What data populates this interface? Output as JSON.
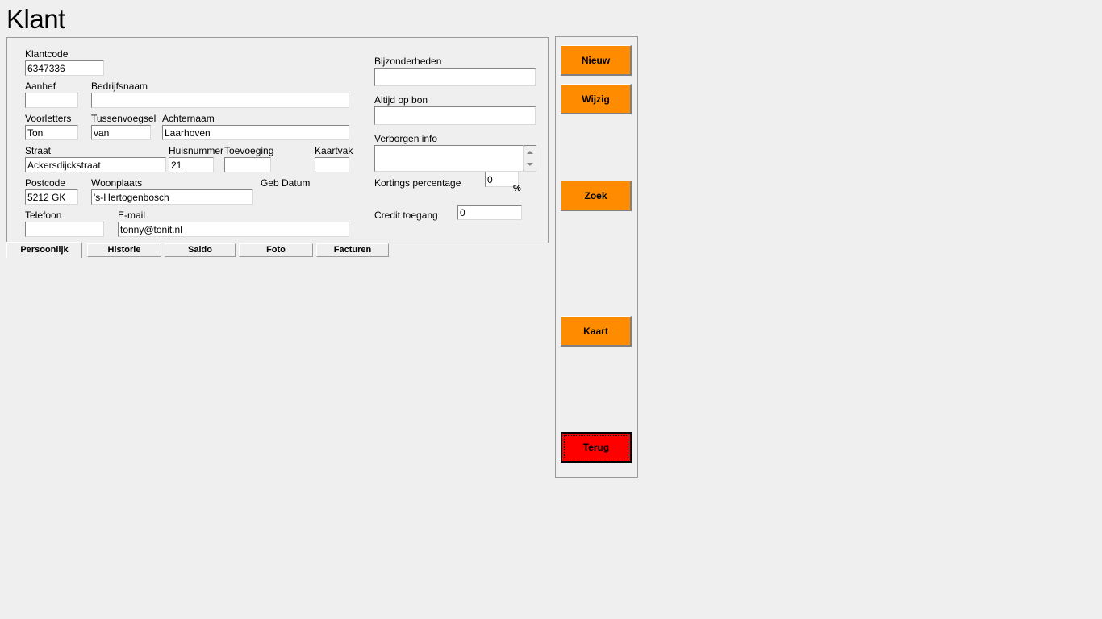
{
  "page": {
    "title": "Klant",
    "background_color": "#efefef"
  },
  "form": {
    "left_column": {
      "klantcode": {
        "label": "Klantcode",
        "value": "6347336"
      },
      "aanhef": {
        "label": "Aanhef",
        "value": ""
      },
      "bedrijfsnaam": {
        "label": "Bedrijfsnaam",
        "value": ""
      },
      "voorletters": {
        "label": "Voorletters",
        "value": "Ton"
      },
      "tussenvoegsel": {
        "label": "Tussenvoegsel",
        "value": "van"
      },
      "achternaam": {
        "label": "Achternaam",
        "value": "Laarhoven"
      },
      "straat": {
        "label": "Straat",
        "value": "Ackersdijckstraat"
      },
      "huisnummer": {
        "label": "Huisnummer",
        "value": "21"
      },
      "toevoeging": {
        "label": "Toevoeging",
        "value": ""
      },
      "kaartvak": {
        "label": "Kaartvak",
        "value": ""
      },
      "postcode": {
        "label": "Postcode",
        "value": "5212 GK"
      },
      "woonplaats": {
        "label": "Woonplaats",
        "value": "'s-Hertogenbosch"
      },
      "geb_datum": {
        "label": "Geb Datum"
      },
      "telefoon": {
        "label": "Telefoon",
        "value": ""
      },
      "email": {
        "label": "E-mail",
        "value": "tonny@tonit.nl"
      }
    },
    "right_column": {
      "bijzonderheden": {
        "label": "Bijzonderheden",
        "value": ""
      },
      "altijd_op_bon": {
        "label": "Altijd op bon",
        "value": ""
      },
      "verborgen_info": {
        "label": "Verborgen info",
        "value": ""
      },
      "kortings_percentage": {
        "label": "Kortings percentage",
        "value": "0",
        "unit": "%"
      },
      "credit_toegang": {
        "label": "Credit toegang",
        "value": "0"
      }
    }
  },
  "tabs": [
    {
      "label": "Persoonlijk",
      "active": true
    },
    {
      "label": "Historie",
      "active": false
    },
    {
      "label": "Saldo",
      "active": false
    },
    {
      "label": "Foto",
      "active": false
    },
    {
      "label": "Facturen",
      "active": false
    }
  ],
  "buttons": [
    {
      "label": "Nieuw",
      "color": "#ff8c00",
      "style": "orange"
    },
    {
      "label": "Wijzig",
      "color": "#ff8c00",
      "style": "orange"
    },
    {
      "label": "Zoek",
      "color": "#ff8c00",
      "style": "orange"
    },
    {
      "label": "Kaart",
      "color": "#ff8c00",
      "style": "orange"
    },
    {
      "label": "Terug",
      "color": "#ff0000",
      "style": "red",
      "focused": true
    }
  ]
}
